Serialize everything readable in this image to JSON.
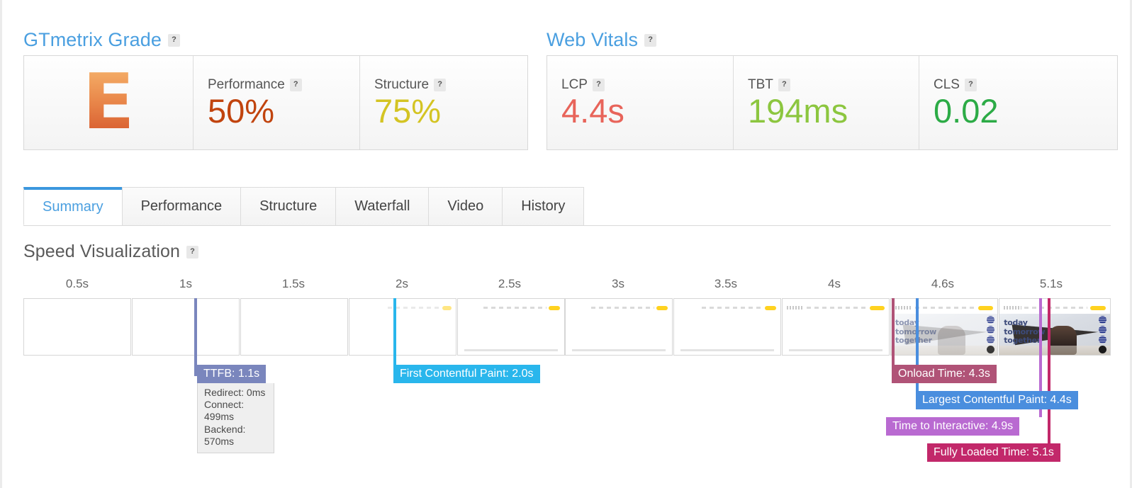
{
  "gtmetrix_grade": {
    "heading": "GTmetrix Grade",
    "help": "?",
    "grade": "E",
    "metrics": [
      {
        "label": "Performance",
        "help": "?",
        "value": "50%",
        "color": "#c1440e"
      },
      {
        "label": "Structure",
        "help": "?",
        "value": "75%",
        "color": "#d4c423"
      }
    ]
  },
  "web_vitals": {
    "heading": "Web Vitals",
    "help": "?",
    "metrics": [
      {
        "label": "LCP",
        "help": "?",
        "value": "4.4s",
        "color": "#e8645a"
      },
      {
        "label": "TBT",
        "help": "?",
        "value": "194ms",
        "color": "#8cc63f"
      },
      {
        "label": "CLS",
        "help": "?",
        "value": "0.02",
        "color": "#2cab46"
      }
    ]
  },
  "tabs": [
    {
      "label": "Summary",
      "active": true
    },
    {
      "label": "Performance",
      "active": false
    },
    {
      "label": "Structure",
      "active": false
    },
    {
      "label": "Waterfall",
      "active": false
    },
    {
      "label": "Video",
      "active": false
    },
    {
      "label": "History",
      "active": false
    }
  ],
  "speed_visualization": {
    "heading": "Speed Visualization",
    "help": "?",
    "ticks": [
      "0.5s",
      "1s",
      "1.5s",
      "2s",
      "2.5s",
      "3s",
      "3.5s",
      "4s",
      "4.6s",
      "5.1s"
    ],
    "events": [
      {
        "name": "TTFB",
        "label": "TTFB: 1.1s",
        "color": "#7a86bd"
      },
      {
        "name": "First Contentful Paint",
        "label": "First Contentful Paint: 2.0s",
        "color": "#29b6ec"
      },
      {
        "name": "Onload Time",
        "label": "Onload Time: 4.3s",
        "color": "#b05377"
      },
      {
        "name": "Largest Contentful Paint",
        "label": "Largest Contentful Paint: 4.4s",
        "color": "#4a8ede"
      },
      {
        "name": "Time to Interactive",
        "label": "Time to Interactive: 4.9s",
        "color": "#b濃"
      },
      {
        "name": "Fully Loaded Time",
        "label": "Fully Loaded Time: 5.1s",
        "color": "#c2286a"
      }
    ],
    "ttfb_breakdown": [
      "Redirect: 0ms",
      "Connect: 499ms",
      "Backend: 570ms"
    ],
    "frame_headline": "today\ntomorrow\ntogether"
  }
}
